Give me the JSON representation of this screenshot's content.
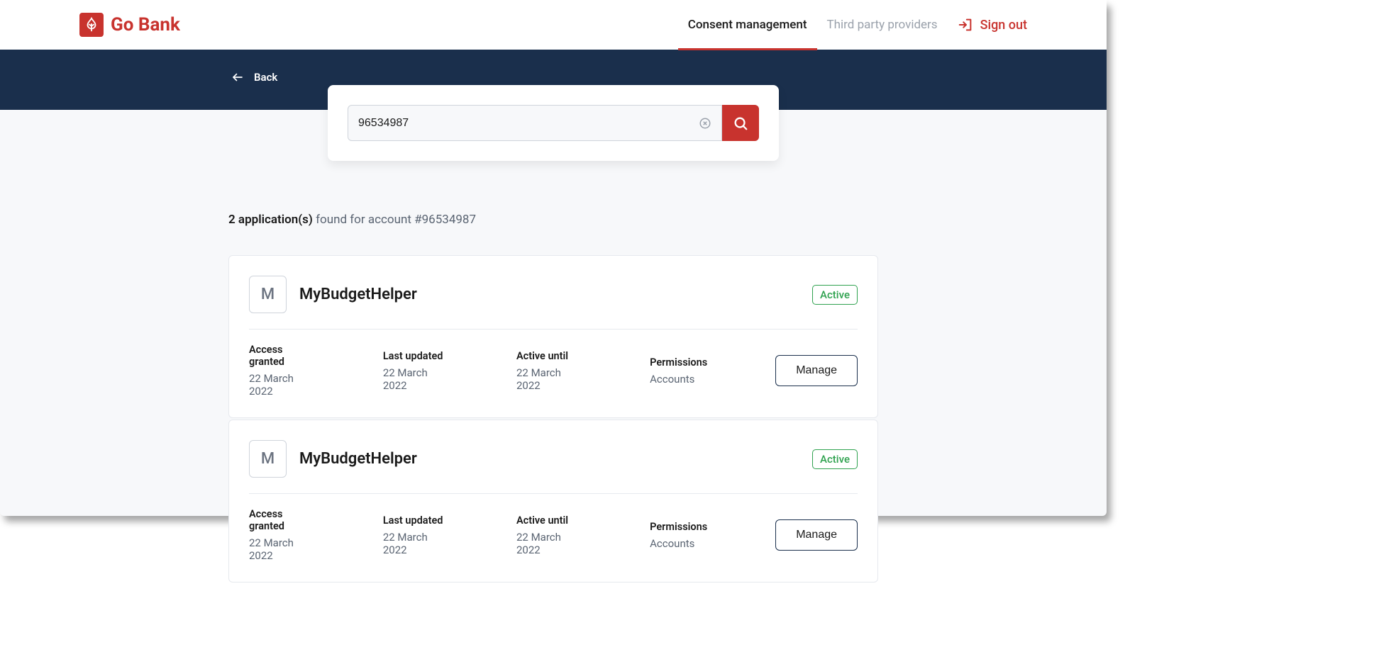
{
  "brand": {
    "name": "Go Bank"
  },
  "nav": {
    "items": [
      {
        "label": "Consent management",
        "active": true
      },
      {
        "label": "Third party providers",
        "active": false
      }
    ],
    "signout_label": "Sign out"
  },
  "subheader": {
    "back_label": "Back"
  },
  "search": {
    "value": "96534987"
  },
  "results": {
    "count_text": "2 application(s)",
    "suffix_text": " found for account #96534987"
  },
  "detail_labels": {
    "access_granted": "Access granted",
    "last_updated": "Last updated",
    "active_until": "Active until",
    "permissions": "Permissions"
  },
  "manage_label": "Manage",
  "apps": [
    {
      "initial": "M",
      "name": "MyBudgetHelper",
      "status": "Active",
      "access_granted": "22 March 2022",
      "last_updated": "22 March 2022",
      "active_until": "22 March 2022",
      "permissions": "Accounts"
    },
    {
      "initial": "M",
      "name": "MyBudgetHelper",
      "status": "Active",
      "access_granted": "22 March 2022",
      "last_updated": "22 March 2022",
      "active_until": "22 March 2022",
      "permissions": "Accounts"
    }
  ]
}
